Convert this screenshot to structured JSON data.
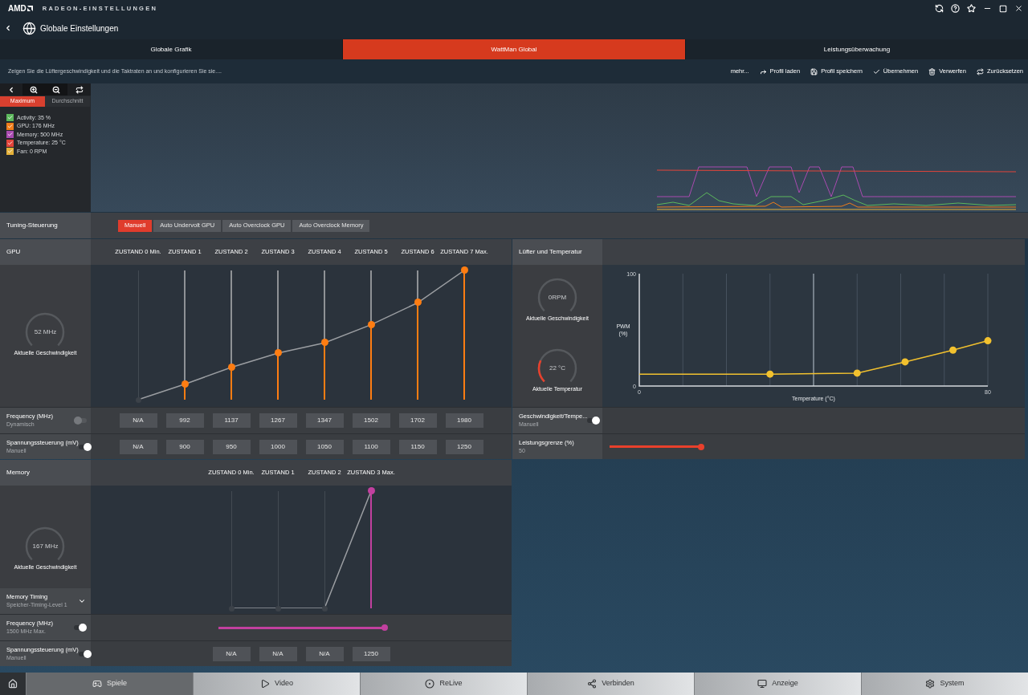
{
  "title_bar": {
    "logo": "AMD",
    "title": "RADEON-EINSTELLUNGEN"
  },
  "header": {
    "title": "Globale Einstellungen"
  },
  "tabs": [
    {
      "label": "Globale Grafik",
      "selected": false
    },
    {
      "label": "WattMan Global",
      "selected": true
    },
    {
      "label": "Leistungsüberwachung",
      "selected": false
    }
  ],
  "toolbar": {
    "description": "Zeigen Sie die Lüftergeschwindigkeit und die Taktraten an und konfigurieren Sie sie....",
    "actions": [
      {
        "kind": "more",
        "label": "mehr..."
      },
      {
        "kind": "load",
        "label": "Profil laden"
      },
      {
        "kind": "save",
        "label": "Profil speichern"
      },
      {
        "kind": "apply",
        "label": "Übernehmen"
      },
      {
        "kind": "discard",
        "label": "Verwerfen"
      },
      {
        "kind": "reset",
        "label": "Zurücksetzen"
      }
    ]
  },
  "monitor": {
    "modes": [
      {
        "label": "Maximum",
        "selected": true
      },
      {
        "label": "Durchschnitt",
        "selected": false
      }
    ],
    "legend": [
      {
        "label": "Activity: 35 %",
        "checked": true,
        "color": "#5cb85c"
      },
      {
        "label": "GPU: 176 MHz",
        "checked": true,
        "color": "#f07d1a"
      },
      {
        "label": "Memory: 500 MHz",
        "checked": true,
        "color": "#a94ab0"
      },
      {
        "label": "Temperature: 25 °C",
        "checked": true,
        "color": "#e2443a"
      },
      {
        "label": "Fan: 0 RPM",
        "checked": true,
        "color": "#e4b13a"
      }
    ]
  },
  "tuning": {
    "label": "Tuning-Steuerung",
    "options": [
      {
        "label": "Manuell",
        "selected": true
      },
      {
        "label": "Auto Undervolt GPU",
        "selected": false
      },
      {
        "label": "Auto Overclock GPU",
        "selected": false
      },
      {
        "label": "Auto Overclock Memory",
        "selected": false
      }
    ]
  },
  "gpu": {
    "title": "GPU",
    "gauge": {
      "value": "52 MHz",
      "caption": "Aktuelle Geschwindigkeit"
    },
    "states": [
      {
        "label": "ZUSTAND 0 Min.",
        "disabled": true,
        "level": 0
      },
      {
        "label": "ZUSTAND 1",
        "disabled": false,
        "level": 0.12
      },
      {
        "label": "ZUSTAND 2",
        "disabled": false,
        "level": 0.25
      },
      {
        "label": "ZUSTAND 3",
        "disabled": false,
        "level": 0.36
      },
      {
        "label": "ZUSTAND 4",
        "disabled": false,
        "level": 0.44
      },
      {
        "label": "ZUSTAND 5",
        "disabled": false,
        "level": 0.58
      },
      {
        "label": "ZUSTAND 6",
        "disabled": false,
        "level": 0.75
      },
      {
        "label": "ZUSTAND 7 Max.",
        "disabled": false,
        "level": 1
      }
    ],
    "rows": [
      {
        "kind": "cells",
        "label": "Frequency (MHz)",
        "value": "Dynamisch",
        "on": false,
        "cells": [
          "N/A",
          "992",
          "1137",
          "1267",
          "1347",
          "1502",
          "1702",
          "1980"
        ]
      },
      {
        "kind": "cells",
        "label": "Spannungssteuerung (mV)",
        "value": "Manuell",
        "on": true,
        "cells": [
          "N/A",
          "900",
          "950",
          "1000",
          "1050",
          "1100",
          "1150",
          "1250"
        ]
      }
    ]
  },
  "fan": {
    "title": "Lüfter und Temperatur",
    "gauges": [
      {
        "value": "0RPM",
        "caption": "Aktuelle Geschwindigkeit"
      },
      {
        "value": "22 °C",
        "caption": "Aktuelle Temperatur",
        "level": 0.26
      }
    ],
    "chart_data": {
      "type": "line",
      "xlabel": "Temperature (°C)",
      "ylabel": "PWM (%)",
      "x": [
        0,
        30,
        50,
        61,
        72,
        80
      ],
      "series": [
        {
          "color": "#f2c12e",
          "marker": "circle",
          "values": [
            10.6,
            10.6,
            11.5,
            21.5,
            32,
            40.3
          ]
        }
      ],
      "xlim": [
        0,
        80
      ],
      "ylim": [
        0,
        100
      ],
      "xticks": [
        0,
        80
      ],
      "yticks": [
        0,
        100
      ],
      "ref_lines": [
        {
          "axis": "x",
          "value": 40
        }
      ]
    },
    "rows": [
      {
        "kind": "toggle",
        "label": "Geschwindigkeit/Tempe...",
        "value": "Manuell",
        "on": true
      },
      {
        "kind": "slider",
        "label": "Leistungsgrenze (%)",
        "value": "50",
        "level": 1
      }
    ]
  },
  "memory": {
    "title": "Memory",
    "gauge": {
      "value": "167 MHz",
      "caption": "Aktuelle Geschwindigkeit"
    },
    "states": [
      {
        "label": "ZUSTAND 0 Min.",
        "disabled": true,
        "level": 0
      },
      {
        "label": "ZUSTAND 1",
        "disabled": true,
        "level": 0
      },
      {
        "label": "ZUSTAND 2",
        "disabled": true,
        "level": 0
      },
      {
        "label": "ZUSTAND 3 Max.",
        "disabled": false,
        "level": 1
      }
    ],
    "timing": {
      "label": "Memory Timing",
      "value": "Speicher-Timing-Level 1"
    },
    "rows": [
      {
        "kind": "slider",
        "label": "Frequency (MHz)",
        "value": "1500 MHz Max.",
        "on": true,
        "level": 1
      },
      {
        "kind": "cells",
        "label": "Spannungssteuerung (mV)",
        "value": "Manuell",
        "on": true,
        "cells": [
          "N/A",
          "N/A",
          "N/A",
          "1250"
        ]
      }
    ]
  },
  "bottom_nav": [
    {
      "kind": "games",
      "label": "Spiele",
      "selected": true
    },
    {
      "kind": "video",
      "label": "Video",
      "selected": false
    },
    {
      "kind": "relive",
      "label": "ReLive",
      "selected": false
    },
    {
      "kind": "connect",
      "label": "Verbinden",
      "selected": false
    },
    {
      "kind": "display",
      "label": "Anzeige",
      "selected": false
    },
    {
      "kind": "system",
      "label": "System",
      "selected": false
    }
  ]
}
